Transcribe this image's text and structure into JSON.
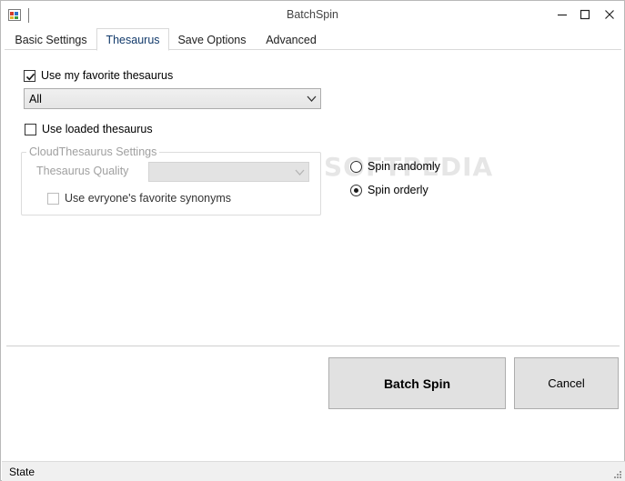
{
  "window": {
    "title": "BatchSpin"
  },
  "icons": {
    "app": "app-icon",
    "minimize": "minimize-icon",
    "maximize": "maximize-icon",
    "close": "close-icon",
    "dropdown": "chevron-down-icon",
    "grip": "resize-grip-icon"
  },
  "tabs": [
    {
      "label": "Basic Settings",
      "active": false
    },
    {
      "label": "Thesaurus",
      "active": true
    },
    {
      "label": "Save Options",
      "active": false
    },
    {
      "label": "Advanced",
      "active": false
    }
  ],
  "thesaurus": {
    "use_favorite": {
      "label": "Use my favorite thesaurus",
      "checked": true
    },
    "favorite_select": {
      "value": "All"
    },
    "use_loaded": {
      "label": "Use loaded thesaurus",
      "checked": false
    },
    "cloud": {
      "group_title": "CloudThesaurus Settings",
      "quality_label": "Thesaurus Quality",
      "quality_value": "",
      "everyone_synonyms": {
        "label": "Use evryone's favorite synonyms",
        "checked": false
      }
    },
    "spin_mode": {
      "options": [
        {
          "label": "Spin randomly",
          "selected": false
        },
        {
          "label": "Spin orderly",
          "selected": true
        }
      ]
    }
  },
  "watermark": "SOFTPEDIA",
  "buttons": {
    "batch_spin": "Batch Spin",
    "cancel": "Cancel"
  },
  "status": {
    "text": "State"
  },
  "colors": {
    "active_tab_text": "#123a6b",
    "button_bg": "#e1e1e1",
    "statusbar_bg": "#f0f0f0"
  }
}
